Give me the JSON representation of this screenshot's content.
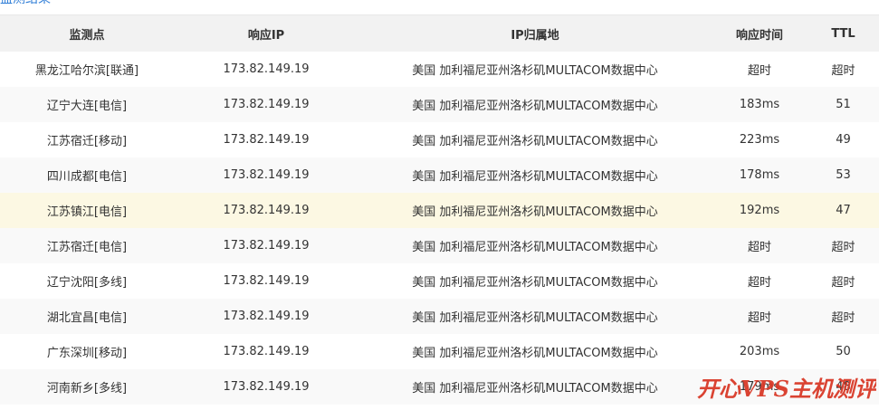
{
  "title": "监测结果",
  "columns": [
    "监测点",
    "响应IP",
    "IP归属地",
    "响应时间",
    "TTL"
  ],
  "colors": {
    "ip_link": "#2b7bd6",
    "timeout_red": "#e02020",
    "header_bg": "#f2f2f2",
    "highlight_row": "#fcf8e3",
    "watermark": "#d93a28"
  },
  "rows": [
    {
      "node": "黑龙江哈尔滨[联通]",
      "ip": "173.82.149.19",
      "location": "美国 加利福尼亚州洛杉矶MULTACOM数据中心",
      "time": "超时",
      "ttl": "超时",
      "time_red": true,
      "ttl_red": true
    },
    {
      "node": "辽宁大连[电信]",
      "ip": "173.82.149.19",
      "location": "美国 加利福尼亚州洛杉矶MULTACOM数据中心",
      "time": "183ms",
      "ttl": "51",
      "time_red": false,
      "ttl_red": false
    },
    {
      "node": "江苏宿迁[移动]",
      "ip": "173.82.149.19",
      "location": "美国 加利福尼亚州洛杉矶MULTACOM数据中心",
      "time": "223ms",
      "ttl": "49",
      "time_red": true,
      "ttl_red": false
    },
    {
      "node": "四川成都[电信]",
      "ip": "173.82.149.19",
      "location": "美国 加利福尼亚州洛杉矶MULTACOM数据中心",
      "time": "178ms",
      "ttl": "53",
      "time_red": false,
      "ttl_red": false
    },
    {
      "node": "江苏镇江[电信]",
      "ip": "173.82.149.19",
      "location": "美国 加利福尼亚州洛杉矶MULTACOM数据中心",
      "time": "192ms",
      "ttl": "47",
      "time_red": false,
      "ttl_red": false,
      "highlight": true
    },
    {
      "node": "江苏宿迁[电信]",
      "ip": "173.82.149.19",
      "location": "美国 加利福尼亚州洛杉矶MULTACOM数据中心",
      "time": "超时",
      "ttl": "超时",
      "time_red": true,
      "ttl_red": true
    },
    {
      "node": "辽宁沈阳[多线]",
      "ip": "173.82.149.19",
      "location": "美国 加利福尼亚州洛杉矶MULTACOM数据中心",
      "time": "超时",
      "ttl": "超时",
      "time_red": true,
      "ttl_red": true
    },
    {
      "node": "湖北宜昌[电信]",
      "ip": "173.82.149.19",
      "location": "美国 加利福尼亚州洛杉矶MULTACOM数据中心",
      "time": "超时",
      "ttl": "超时",
      "time_red": true,
      "ttl_red": true
    },
    {
      "node": "广东深圳[移动]",
      "ip": "173.82.149.19",
      "location": "美国 加利福尼亚州洛杉矶MULTACOM数据中心",
      "time": "203ms",
      "ttl": "50",
      "time_red": true,
      "ttl_red": false
    },
    {
      "node": "河南新乡[多线]",
      "ip": "173.82.149.19",
      "location": "美国 加利福尼亚州洛杉矶MULTACOM数据中心",
      "time": "179ms",
      "ttl": "48",
      "time_red": false,
      "ttl_red": false
    }
  ],
  "watermark": {
    "text": "开心VPS主机测评",
    "color": "#d93a28"
  }
}
